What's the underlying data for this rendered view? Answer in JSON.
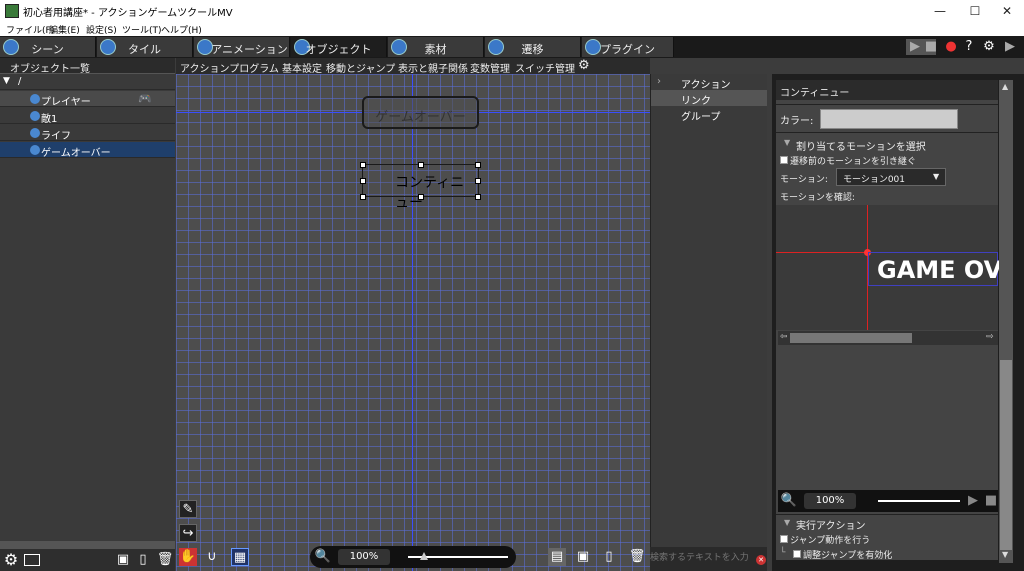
{
  "window": {
    "title": "初心者用講座* - アクションゲームツクールMV",
    "minimize": "—",
    "maximize": "☐",
    "close": "✕"
  },
  "menu": [
    "ファイル(F)",
    "編集(E)",
    "設定(S)",
    "ツール(T)",
    "ヘルプ(H)"
  ],
  "tabs": [
    {
      "label": "シーン",
      "icon": "scene-icon"
    },
    {
      "label": "タイル",
      "icon": "tile-icon"
    },
    {
      "label": "アニメーション",
      "icon": "animation-icon"
    },
    {
      "label": "オブジェクト",
      "icon": "object-icon"
    },
    {
      "label": "素材",
      "icon": "material-icon"
    },
    {
      "label": "遷移",
      "icon": "transition-icon"
    },
    {
      "label": "プラグイン",
      "icon": "plugin-icon"
    }
  ],
  "active_tab": "オブジェクト",
  "left_panel": {
    "header": "オブジェクト一覧",
    "root": "/",
    "items": [
      "プレイヤー",
      "敵1",
      "ライフ",
      "ゲームオーバー"
    ],
    "selected": "ゲームオーバー"
  },
  "sub_tabs": [
    "アクションプログラム",
    "基本設定",
    "移動とジャンプ",
    "表示と親子関係",
    "変数管理",
    "スイッチ管理"
  ],
  "canvas": {
    "node_gameover": "ゲームオーバー",
    "node_continue": "コンティニュー",
    "zoom": "100%"
  },
  "mid_panel": {
    "items": [
      "アクション",
      "リンク",
      "グループ"
    ],
    "search_placeholder": "検索するテキストを入力"
  },
  "right_panel": {
    "title": "コンティニュー",
    "color_label": "カラー:",
    "section_motion": "割り当てるモーションを選択",
    "inherit_motion": "遷移前のモーションを引き継ぐ",
    "motion_label": "モーション:",
    "motion_value": "モーション001",
    "confirm_label": "モーションを確認:",
    "preview_text": "GAME OV",
    "zoom": "100%",
    "section_exec": "実行アクション",
    "do_jump": "ジャンプ動作を行う",
    "enable_adjust": "調整ジャンプを有効化"
  }
}
